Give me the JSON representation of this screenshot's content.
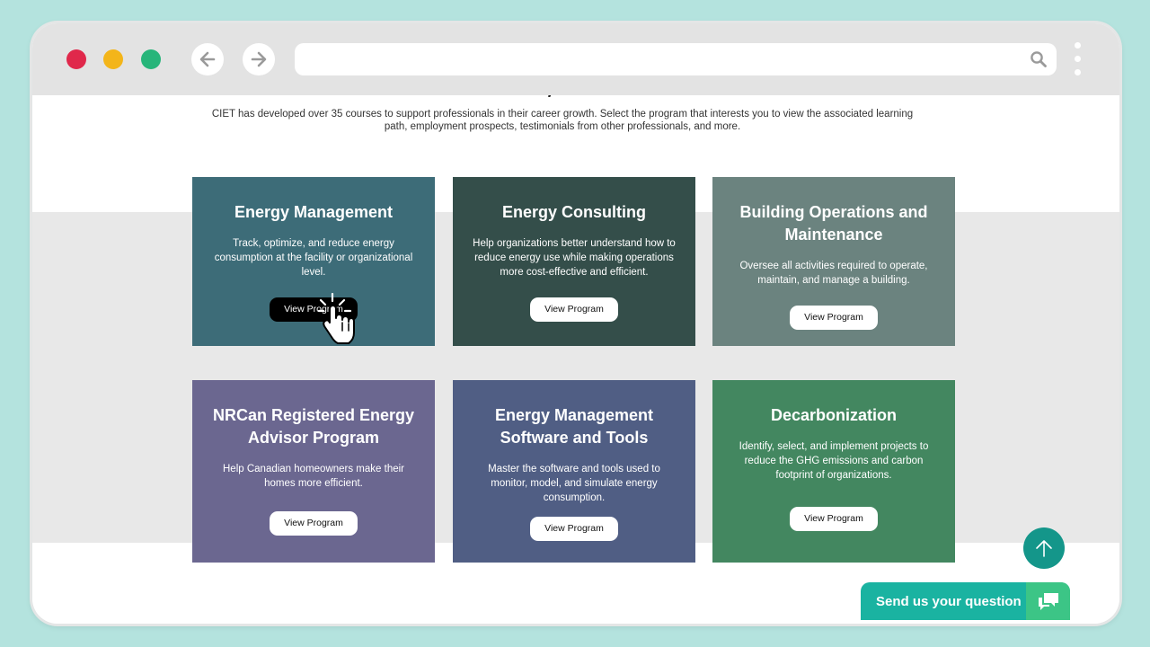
{
  "browser": {
    "back_icon": "arrow-left-icon",
    "forward_icon": "arrow-right-icon",
    "address_value": "",
    "search_icon": "search-icon",
    "menu_icon": "kebab-menu-icon"
  },
  "page": {
    "intro": "CIET has developed over 35 courses to support professionals in their career growth. Select the program that interests you to view the associated learning path, employment prospects, testimonials from other professionals, and more."
  },
  "cards": [
    {
      "title": "Energy Management",
      "description": "Track, optimize, and reduce energy consumption at the facility or organizational level.",
      "button": "View Program",
      "color": "#3d6c78"
    },
    {
      "title": "Energy Consulting",
      "description": "Help organizations better understand how to reduce energy use while making operations more cost-effective and efficient.",
      "button": "View Program",
      "color": "#344e4a"
    },
    {
      "title": "Building Operations and Maintenance",
      "description": "Oversee all activities required to operate, maintain, and manage a building.",
      "button": "View Program",
      "color": "#6b837f"
    },
    {
      "title": "NRCan Registered Energy Advisor Program",
      "description": "Help Canadian homeowners make their homes more efficient.",
      "button": "View Program",
      "color": "#6b6790"
    },
    {
      "title": "Energy Management Software and Tools",
      "description": "Master the software and tools used to monitor, model, and simulate energy consumption.",
      "button": "View Program",
      "color": "#505e84"
    },
    {
      "title": "Decarbonization",
      "description": "Identify, select, and implement projects to reduce the GHG emissions and carbon footprint of organizations.",
      "button": "View Program",
      "color": "#438760"
    }
  ],
  "widgets": {
    "scroll_top_icon": "arrow-up-icon",
    "ask_label": "Send us your question",
    "ask_icon": "chat-bubbles-icon"
  },
  "colors": {
    "background": "#b4e3de",
    "accent_teal": "#1ab3a1",
    "accent_green": "#3cc586"
  }
}
